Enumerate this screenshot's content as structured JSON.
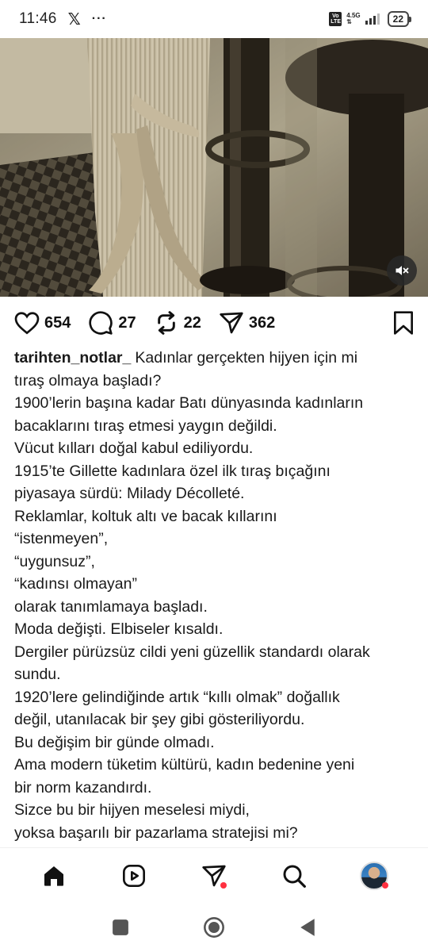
{
  "status_bar": {
    "time": "11:46",
    "x_app": "𝕏",
    "more": "···",
    "volte": "Vo LTE",
    "network_speed": "4.5G",
    "battery_level": "22"
  },
  "media": {
    "mute_icon": "speaker-muted-icon"
  },
  "actions": {
    "likes": "654",
    "comments": "27",
    "reposts": "22",
    "shares": "362"
  },
  "caption": {
    "username": "tarihten_notlar_",
    "lines": [
      "Kadınlar gerçekten hijyen için mi",
      "tıraş olmaya başladı?",
      "1900’lerin başına kadar Batı dünyasında kadınların",
      "bacaklarını tıraş etmesi yaygın değildi.",
      "Vücut kılları doğal kabul ediliyordu.",
      "1915’te Gillette kadınlara özel ilk tıraş bıçağını",
      "piyasaya sürdü: Milady Décolleté.",
      "Reklamlar, koltuk altı ve bacak kıllarını",
      "“istenmeyen”,",
      "“uygunsuz”,",
      "“kadınsı olmayan”",
      "olarak tanımlamaya başladı.",
      "Moda değişti. Elbiseler kısaldı.",
      "Dergiler pürüzsüz cildi yeni güzellik standardı olarak",
      "sundu.",
      "1920’lere gelindiğinde artık “kıllı olmak” doğallık",
      "değil, utanılacak bir şey gibi gösteriliyordu.",
      "Bu değişim bir günde olmadı.",
      "Ama modern tüketim kültürü, kadın bedenine yeni",
      "bir norm kazandırdı.",
      "Sizce bu bir hijyen meselesi miydi,",
      "yoksa başarılı bir pazarlama stratejisi mi?"
    ]
  },
  "colors": {
    "notification_dot": "#ff3040",
    "sepia_dark": "#3b3428",
    "sepia_light": "#d8cfb6"
  }
}
